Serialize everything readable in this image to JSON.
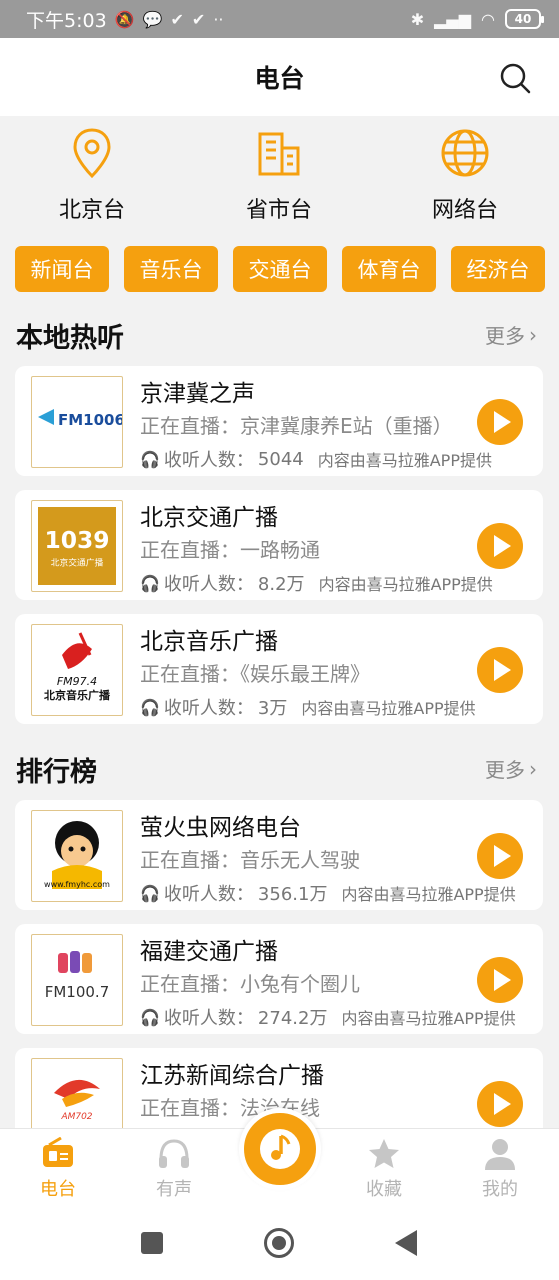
{
  "status_bar": {
    "time": "下午5:03",
    "battery": "40"
  },
  "header": {
    "title": "电台"
  },
  "categories": [
    {
      "label": "北京台",
      "icon": "location-pin-icon"
    },
    {
      "label": "省市台",
      "icon": "building-icon"
    },
    {
      "label": "网络台",
      "icon": "globe-icon"
    }
  ],
  "chips": [
    "新闻台",
    "音乐台",
    "交通台",
    "体育台",
    "经济台"
  ],
  "local_section": {
    "title": "本地热听",
    "more": "更多",
    "items": [
      {
        "name": "京津冀之声",
        "now": "正在直播：京津冀康养E站（重播）",
        "listeners_label": "收听人数：",
        "listeners": "5044",
        "source": "内容由喜马拉雅APP提供",
        "logo_text": "FM1006"
      },
      {
        "name": "北京交通广播",
        "now": "正在直播：一路畅通",
        "listeners_label": "收听人数：",
        "listeners": "8.2万",
        "source": "内容由喜马拉雅APP提供",
        "logo_text": "1039",
        "logo_sub": "北京交通广播"
      },
      {
        "name": "北京音乐广播",
        "now": "正在直播：《娱乐最王牌》",
        "listeners_label": "收听人数：",
        "listeners": "3万",
        "source": "内容由喜马拉雅APP提供",
        "logo_text": "FM97.4",
        "logo_sub": "北京音乐广播"
      }
    ]
  },
  "rank_section": {
    "title": "排行榜",
    "more": "更多",
    "items": [
      {
        "name": "萤火虫网络电台",
        "now": "正在直播：音乐无人驾驶",
        "listeners_label": "收听人数：",
        "listeners": "356.1万",
        "source": "内容由喜马拉雅APP提供",
        "logo_text": "www.fmyhc.com"
      },
      {
        "name": "福建交通广播",
        "now": "正在直播：小兔有个圈儿",
        "listeners_label": "收听人数：",
        "listeners": "274.2万",
        "source": "内容由喜马拉雅APP提供",
        "logo_text": "FM100.7"
      },
      {
        "name": "江苏新闻综合广播",
        "now": "正在直播：法治在线",
        "logo_text": "AM702"
      }
    ]
  },
  "tabs": [
    {
      "label": "电台",
      "icon": "radio-icon",
      "active": true
    },
    {
      "label": "有声",
      "icon": "headphones-icon",
      "active": false
    },
    {
      "label": "收藏",
      "icon": "star-icon",
      "active": false
    },
    {
      "label": "我的",
      "icon": "person-icon",
      "active": false
    }
  ],
  "colors": {
    "accent": "#f5a00f",
    "muted": "#8a8a8a"
  }
}
